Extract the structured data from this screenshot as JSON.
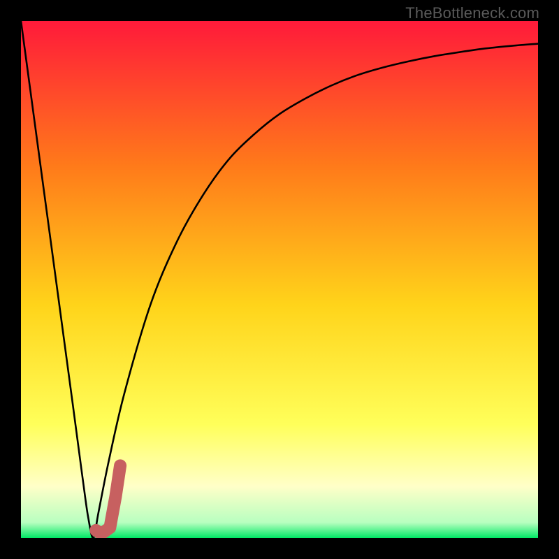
{
  "attribution": "TheBottleneck.com",
  "colors": {
    "top": "#ff1a3a",
    "mid1": "#ff7a1a",
    "mid2": "#ffd41a",
    "mid3": "#ffff5a",
    "pale": "#ffffc8",
    "green": "#00e865",
    "curve": "#000000",
    "mark": "#c76060",
    "frame": "#000000"
  },
  "chart_data": {
    "type": "line",
    "title": "",
    "xlabel": "",
    "ylabel": "",
    "xlim": [
      0,
      100
    ],
    "ylim": [
      0,
      100
    ],
    "series": [
      {
        "name": "bottleneck-curve",
        "x": [
          0,
          5,
          10,
          12,
          13,
          14,
          15,
          17,
          20,
          25,
          30,
          35,
          40,
          45,
          50,
          55,
          60,
          65,
          70,
          75,
          80,
          85,
          90,
          95,
          100
        ],
        "y": [
          100,
          63,
          26,
          11,
          4,
          0,
          5,
          15,
          28,
          45,
          57,
          66,
          73,
          78,
          82,
          85,
          87.5,
          89.5,
          91,
          92.2,
          93.2,
          94,
          94.7,
          95.2,
          95.6
        ]
      }
    ],
    "marker": {
      "name": "highlight-j",
      "points": [
        {
          "x": 14.5,
          "y": 1.5
        },
        {
          "x": 15.5,
          "y": 0.8
        },
        {
          "x": 17.2,
          "y": 2.0
        },
        {
          "x": 18.3,
          "y": 8.0
        },
        {
          "x": 19.2,
          "y": 14.0
        }
      ]
    },
    "gradient_stops": [
      {
        "pos": 0.0,
        "color": "#ff1a3a"
      },
      {
        "pos": 0.28,
        "color": "#ff7a1a"
      },
      {
        "pos": 0.55,
        "color": "#ffd41a"
      },
      {
        "pos": 0.78,
        "color": "#ffff5a"
      },
      {
        "pos": 0.9,
        "color": "#ffffc8"
      },
      {
        "pos": 0.97,
        "color": "#b8ffc0"
      },
      {
        "pos": 1.0,
        "color": "#00e865"
      }
    ]
  }
}
